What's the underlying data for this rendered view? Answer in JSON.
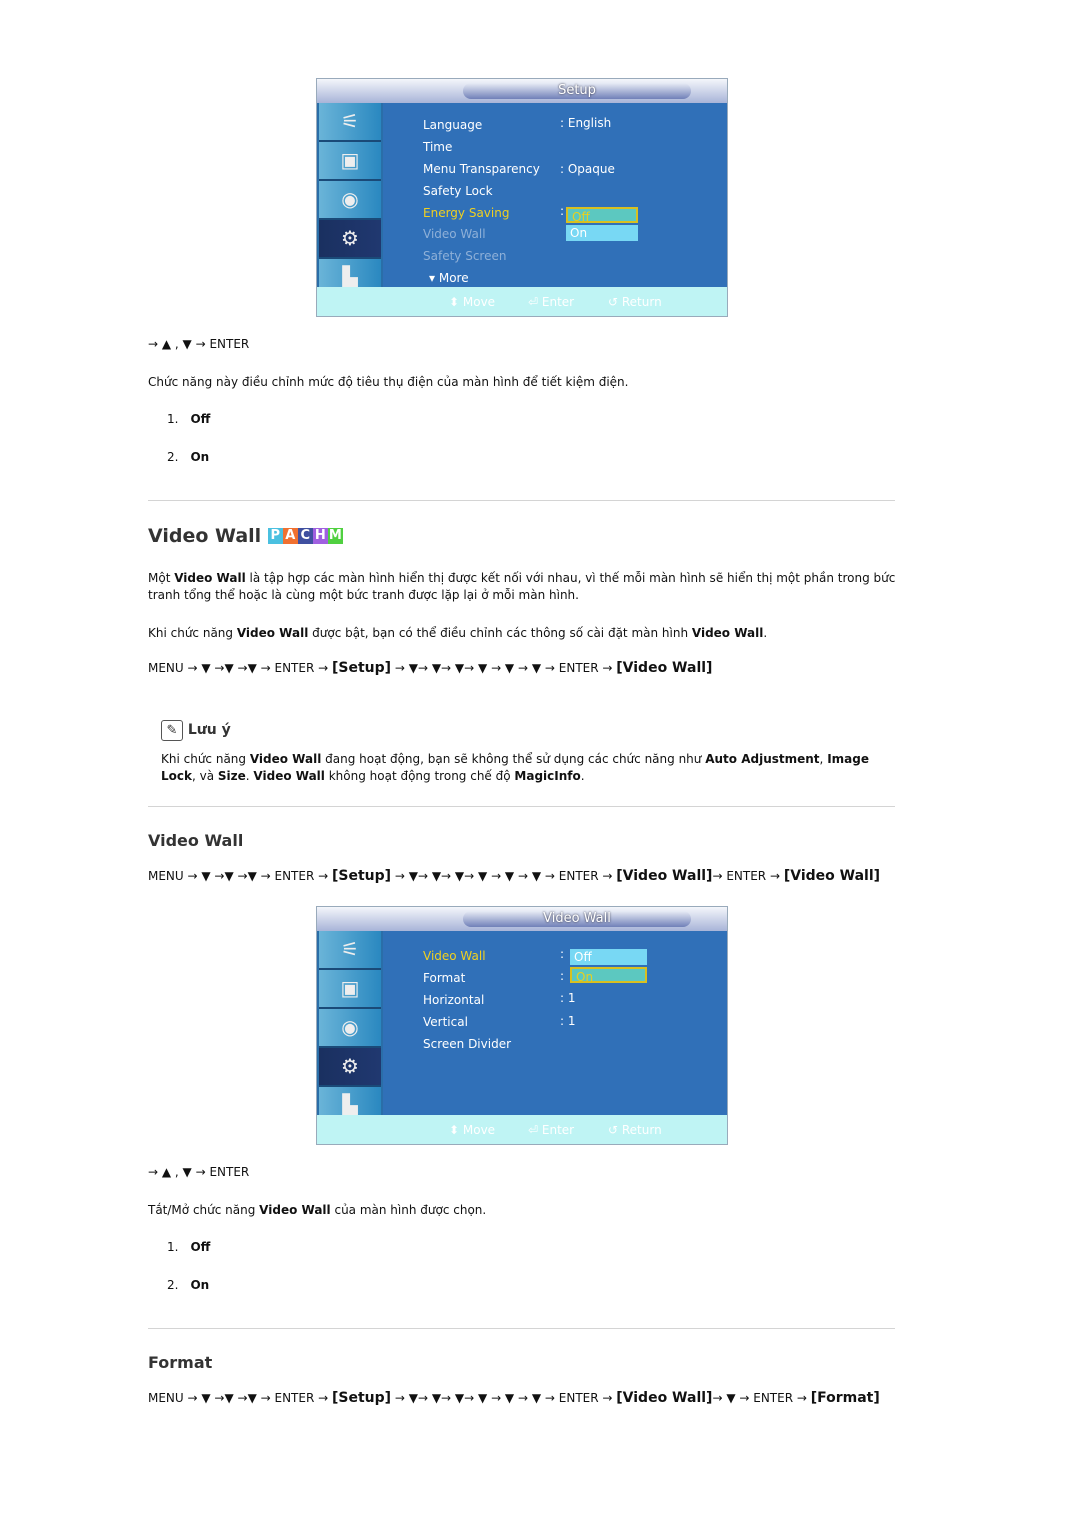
{
  "osd1": {
    "title": "Setup",
    "items": [
      "Language",
      "Time",
      "Menu Transparency",
      "Safety Lock",
      "Energy Saving",
      "Video Wall",
      "Safety Screen",
      "More"
    ],
    "values": {
      "language": ": English",
      "menu_transparency": ": Opaque",
      "energy_colon": ":"
    },
    "options": [
      "Off",
      "On"
    ],
    "footer": {
      "move": "Move",
      "enter": "Enter",
      "return": "Return"
    },
    "icons": [
      "input-icon",
      "picture-icon",
      "sound-icon",
      "setup-gear-icon",
      "multi-control-icon"
    ]
  },
  "osd2": {
    "title": "Video Wall",
    "items": [
      "Video Wall",
      "Format",
      "Horizontal",
      "Vertical",
      "Screen Divider"
    ],
    "values": {
      "colon": ":",
      "horizontal": ": 1",
      "vertical": ": 1"
    },
    "options": [
      "Off",
      "On"
    ],
    "footer": {
      "move": "Move",
      "enter": "Enter",
      "return": "Return"
    }
  },
  "energy": {
    "nav": "→ ▲ , ▼ → ENTER",
    "desc": "Chức năng này điều chỉnh mức độ tiêu thụ điện của màn hình để tiết kiệm điện.",
    "list": [
      {
        "n": "1.",
        "label": "Off"
      },
      {
        "n": "2.",
        "label": "On"
      }
    ]
  },
  "videowall": {
    "title": "Video Wall",
    "badges": [
      "P",
      "A",
      "C",
      "H",
      "M"
    ],
    "badge_colors": [
      "#4ac0e0",
      "#f07030",
      "#4050a0",
      "#a060e0",
      "#50d040"
    ],
    "p1": [
      [
        "Một ",
        0
      ],
      [
        "Video Wall",
        1
      ],
      [
        " là tập hợp các màn hình hiển thị được kết nối với nhau, vì thế mỗi màn hình sẽ hiển thị một phần trong bức tranh tổng thể hoặc là cùng một bức tranh được lặp lại ở mỗi màn hình.",
        0
      ]
    ],
    "p2": [
      [
        "Khi chức năng ",
        0
      ],
      [
        "Video Wall",
        1
      ],
      [
        " được bật, bạn có thể điều chỉnh các thông số cài đặt màn hình ",
        0
      ],
      [
        "Video Wall",
        1
      ],
      [
        ".",
        0
      ]
    ],
    "path": [
      [
        "MENU → ▼ →▼ →▼ → ENTER → ",
        0
      ],
      [
        "[Setup]",
        2
      ],
      [
        " → ▼→ ▼→ ▼→ ▼ → ▼ → ▼ → ENTER → ",
        0
      ],
      [
        "[Video Wall]",
        2
      ]
    ],
    "note_title": "Lưu ý",
    "note": [
      [
        "Khi chức năng ",
        0
      ],
      [
        "Video Wall",
        1
      ],
      [
        " đang hoạt động, bạn sẽ không thể sử dụng các chức năng như ",
        0
      ],
      [
        "Auto Adjustment",
        1
      ],
      [
        ", ",
        0
      ],
      [
        "Image Lock",
        1
      ],
      [
        ", và ",
        0
      ],
      [
        "Size",
        1
      ],
      [
        ". ",
        0
      ],
      [
        "Video Wall",
        1
      ],
      [
        " không hoạt động trong chế độ ",
        0
      ],
      [
        "MagicInfo",
        1
      ],
      [
        ".",
        0
      ]
    ]
  },
  "vw2": {
    "title": "Video Wall",
    "path": [
      [
        "MENU → ▼ →▼ →▼ → ENTER → ",
        0
      ],
      [
        "[Setup]",
        2
      ],
      [
        " → ▼→ ▼→ ▼→ ▼ → ▼ → ▼ → ENTER → ",
        0
      ],
      [
        "[Video Wall]",
        2
      ],
      [
        "→ ENTER → ",
        0
      ],
      [
        "[Video Wall]",
        2
      ]
    ],
    "nav": "→ ▲ , ▼ → ENTER",
    "desc": [
      [
        "Tắt/Mở chức năng ",
        0
      ],
      [
        "Video Wall",
        1
      ],
      [
        " của màn hình được chọn.",
        0
      ]
    ],
    "list": [
      {
        "n": "1.",
        "label": "Off"
      },
      {
        "n": "2.",
        "label": "On"
      }
    ]
  },
  "format": {
    "title": "Format",
    "path": [
      [
        "MENU → ▼ →▼ →▼ → ENTER → ",
        0
      ],
      [
        "[Setup]",
        2
      ],
      [
        " → ▼→ ▼→ ▼→ ▼ → ▼ → ▼ → ENTER → ",
        0
      ],
      [
        "[Video Wall]",
        2
      ],
      [
        "→ ▼ → ENTER → ",
        0
      ],
      [
        "[Format]",
        2
      ]
    ]
  }
}
